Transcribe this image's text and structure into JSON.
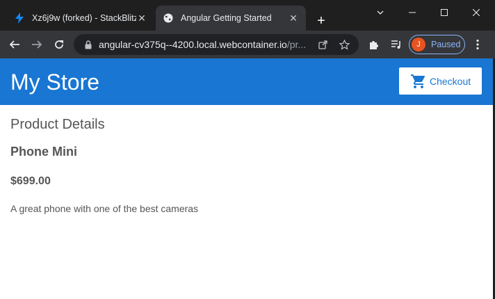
{
  "browser": {
    "tabs": [
      {
        "title": "Xz6j9w (forked) - StackBlitz",
        "favicon": "stackblitz-bolt-icon",
        "active": false
      },
      {
        "title": "Angular Getting Started",
        "favicon": "globe-icon",
        "active": true
      }
    ],
    "url": {
      "host": "angular-cv375q--4200.local.webcontainer.io",
      "path": "/pr..."
    },
    "profile_initial": "J",
    "profile_status": "Paused",
    "colors": {
      "tabstrip": "#1f1f1f",
      "toolbar": "#35363a",
      "omnibox": "#202124",
      "avatar": "#e8531f",
      "profile_outline": "#8ab4f8"
    }
  },
  "page": {
    "store_title": "My Store",
    "checkout_label": "Checkout",
    "section_title": "Product Details",
    "product": {
      "name": "Phone Mini",
      "price": "$699.00",
      "description": "A great phone with one of the best cameras"
    },
    "colors": {
      "topbar": "#1976d2",
      "text": "#555555"
    }
  }
}
